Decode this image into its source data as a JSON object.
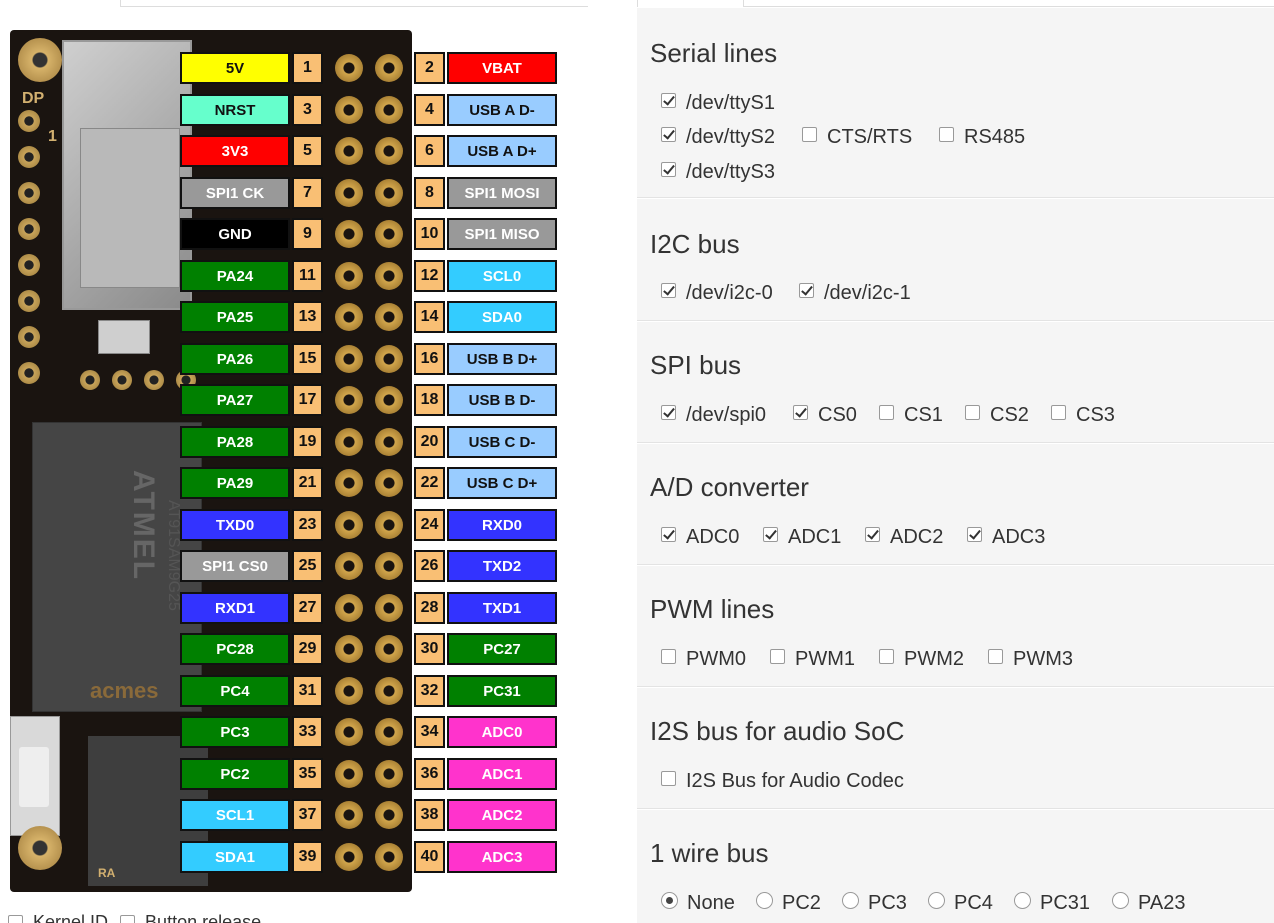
{
  "pinout": {
    "left": [
      {
        "label": "5V",
        "num": "1",
        "bg": "#ffff00",
        "fg": "#111111"
      },
      {
        "label": "NRST",
        "num": "3",
        "bg": "#66ffcc",
        "fg": "#111111"
      },
      {
        "label": "3V3",
        "num": "5",
        "bg": "#ff0000",
        "fg": "#ffffff"
      },
      {
        "label": "SPI1 CK",
        "num": "7",
        "bg": "#999999",
        "fg": "#ffffff"
      },
      {
        "label": "GND",
        "num": "9",
        "bg": "#000000",
        "fg": "#ffffff"
      },
      {
        "label": "PA24",
        "num": "11",
        "bg": "#008000",
        "fg": "#ffffff"
      },
      {
        "label": "PA25",
        "num": "13",
        "bg": "#008000",
        "fg": "#ffffff"
      },
      {
        "label": "PA26",
        "num": "15",
        "bg": "#008000",
        "fg": "#ffffff"
      },
      {
        "label": "PA27",
        "num": "17",
        "bg": "#008000",
        "fg": "#ffffff"
      },
      {
        "label": "PA28",
        "num": "19",
        "bg": "#008000",
        "fg": "#ffffff"
      },
      {
        "label": "PA29",
        "num": "21",
        "bg": "#008000",
        "fg": "#ffffff"
      },
      {
        "label": "TXD0",
        "num": "23",
        "bg": "#3333ff",
        "fg": "#ffffff"
      },
      {
        "label": "SPI1 CS0",
        "num": "25",
        "bg": "#999999",
        "fg": "#ffffff"
      },
      {
        "label": "RXD1",
        "num": "27",
        "bg": "#3333ff",
        "fg": "#ffffff"
      },
      {
        "label": "PC28",
        "num": "29",
        "bg": "#008000",
        "fg": "#ffffff"
      },
      {
        "label": "PC4",
        "num": "31",
        "bg": "#008000",
        "fg": "#ffffff"
      },
      {
        "label": "PC3",
        "num": "33",
        "bg": "#008000",
        "fg": "#ffffff"
      },
      {
        "label": "PC2",
        "num": "35",
        "bg": "#008000",
        "fg": "#ffffff"
      },
      {
        "label": "SCL1",
        "num": "37",
        "bg": "#33ccff",
        "fg": "#ffffff"
      },
      {
        "label": "SDA1",
        "num": "39",
        "bg": "#33ccff",
        "fg": "#ffffff"
      }
    ],
    "right": [
      {
        "label": "VBAT",
        "num": "2",
        "bg": "#ff0000",
        "fg": "#ffffff"
      },
      {
        "label": "USB A D-",
        "num": "4",
        "bg": "#99ccff",
        "fg": "#111111"
      },
      {
        "label": "USB A D+",
        "num": "6",
        "bg": "#99ccff",
        "fg": "#111111"
      },
      {
        "label": "SPI1 MOSI",
        "num": "8",
        "bg": "#999999",
        "fg": "#ffffff"
      },
      {
        "label": "SPI1 MISO",
        "num": "10",
        "bg": "#999999",
        "fg": "#ffffff"
      },
      {
        "label": "SCL0",
        "num": "12",
        "bg": "#33ccff",
        "fg": "#ffffff"
      },
      {
        "label": "SDA0",
        "num": "14",
        "bg": "#33ccff",
        "fg": "#ffffff"
      },
      {
        "label": "USB B D+",
        "num": "16",
        "bg": "#99ccff",
        "fg": "#111111"
      },
      {
        "label": "USB B D-",
        "num": "18",
        "bg": "#99ccff",
        "fg": "#111111"
      },
      {
        "label": "USB C D-",
        "num": "20",
        "bg": "#99ccff",
        "fg": "#111111"
      },
      {
        "label": "USB C D+",
        "num": "22",
        "bg": "#99ccff",
        "fg": "#111111"
      },
      {
        "label": "RXD0",
        "num": "24",
        "bg": "#3333ff",
        "fg": "#ffffff"
      },
      {
        "label": "TXD2",
        "num": "26",
        "bg": "#3333ff",
        "fg": "#ffffff"
      },
      {
        "label": "TXD1",
        "num": "28",
        "bg": "#3333ff",
        "fg": "#ffffff"
      },
      {
        "label": "PC27",
        "num": "30",
        "bg": "#008000",
        "fg": "#ffffff"
      },
      {
        "label": "PC31",
        "num": "32",
        "bg": "#008000",
        "fg": "#ffffff"
      },
      {
        "label": "ADC0",
        "num": "34",
        "bg": "#ff33cc",
        "fg": "#ffffff"
      },
      {
        "label": "ADC1",
        "num": "36",
        "bg": "#ff33cc",
        "fg": "#ffffff"
      },
      {
        "label": "ADC2",
        "num": "38",
        "bg": "#ff33cc",
        "fg": "#ffffff"
      },
      {
        "label": "ADC3",
        "num": "40",
        "bg": "#ff33cc",
        "fg": "#ffffff"
      }
    ]
  },
  "board": {
    "brand": "acmes",
    "chip_logo": "ATMEL",
    "chip_part": "AT91SAM9G25",
    "silk_dp": "DP",
    "silk_one": "1",
    "silk_ra": "RA"
  },
  "bottom_left": {
    "option1": "Kernel ID",
    "option2": "Button release"
  },
  "config": {
    "serial": {
      "title": "Serial lines",
      "ttyS1": {
        "label": "/dev/ttyS1",
        "checked": true
      },
      "ttyS2": {
        "label": "/dev/ttyS2",
        "checked": true
      },
      "ctsrts": {
        "label": "CTS/RTS",
        "checked": false
      },
      "rs485": {
        "label": "RS485",
        "checked": false
      },
      "ttyS3": {
        "label": "/dev/ttyS3",
        "checked": true
      }
    },
    "i2c": {
      "title": "I2C bus",
      "i2c0": {
        "label": "/dev/i2c-0",
        "checked": true
      },
      "i2c1": {
        "label": "/dev/i2c-1",
        "checked": true
      }
    },
    "spi": {
      "title": "SPI bus",
      "spi0": {
        "label": "/dev/spi0",
        "checked": true
      },
      "cs0": {
        "label": "CS0",
        "checked": true
      },
      "cs1": {
        "label": "CS1",
        "checked": false
      },
      "cs2": {
        "label": "CS2",
        "checked": false
      },
      "cs3": {
        "label": "CS3",
        "checked": false
      }
    },
    "adc": {
      "title": "A/D converter",
      "adc0": {
        "label": "ADC0",
        "checked": true
      },
      "adc1": {
        "label": "ADC1",
        "checked": true
      },
      "adc2": {
        "label": "ADC2",
        "checked": true
      },
      "adc3": {
        "label": "ADC3",
        "checked": true
      }
    },
    "pwm": {
      "title": "PWM lines",
      "pwm0": {
        "label": "PWM0",
        "checked": false
      },
      "pwm1": {
        "label": "PWM1",
        "checked": false
      },
      "pwm2": {
        "label": "PWM2",
        "checked": false
      },
      "pwm3": {
        "label": "PWM3",
        "checked": false
      }
    },
    "i2s": {
      "title": "I2S bus for audio SoC",
      "codec": {
        "label": "I2S Bus for Audio Codec",
        "checked": false
      }
    },
    "onewire": {
      "title": "1 wire bus",
      "selected": "None",
      "none": "None",
      "pc2": "PC2",
      "pc3": "PC3",
      "pc4": "PC4",
      "pc31": "PC31",
      "pa23": "PA23"
    }
  }
}
